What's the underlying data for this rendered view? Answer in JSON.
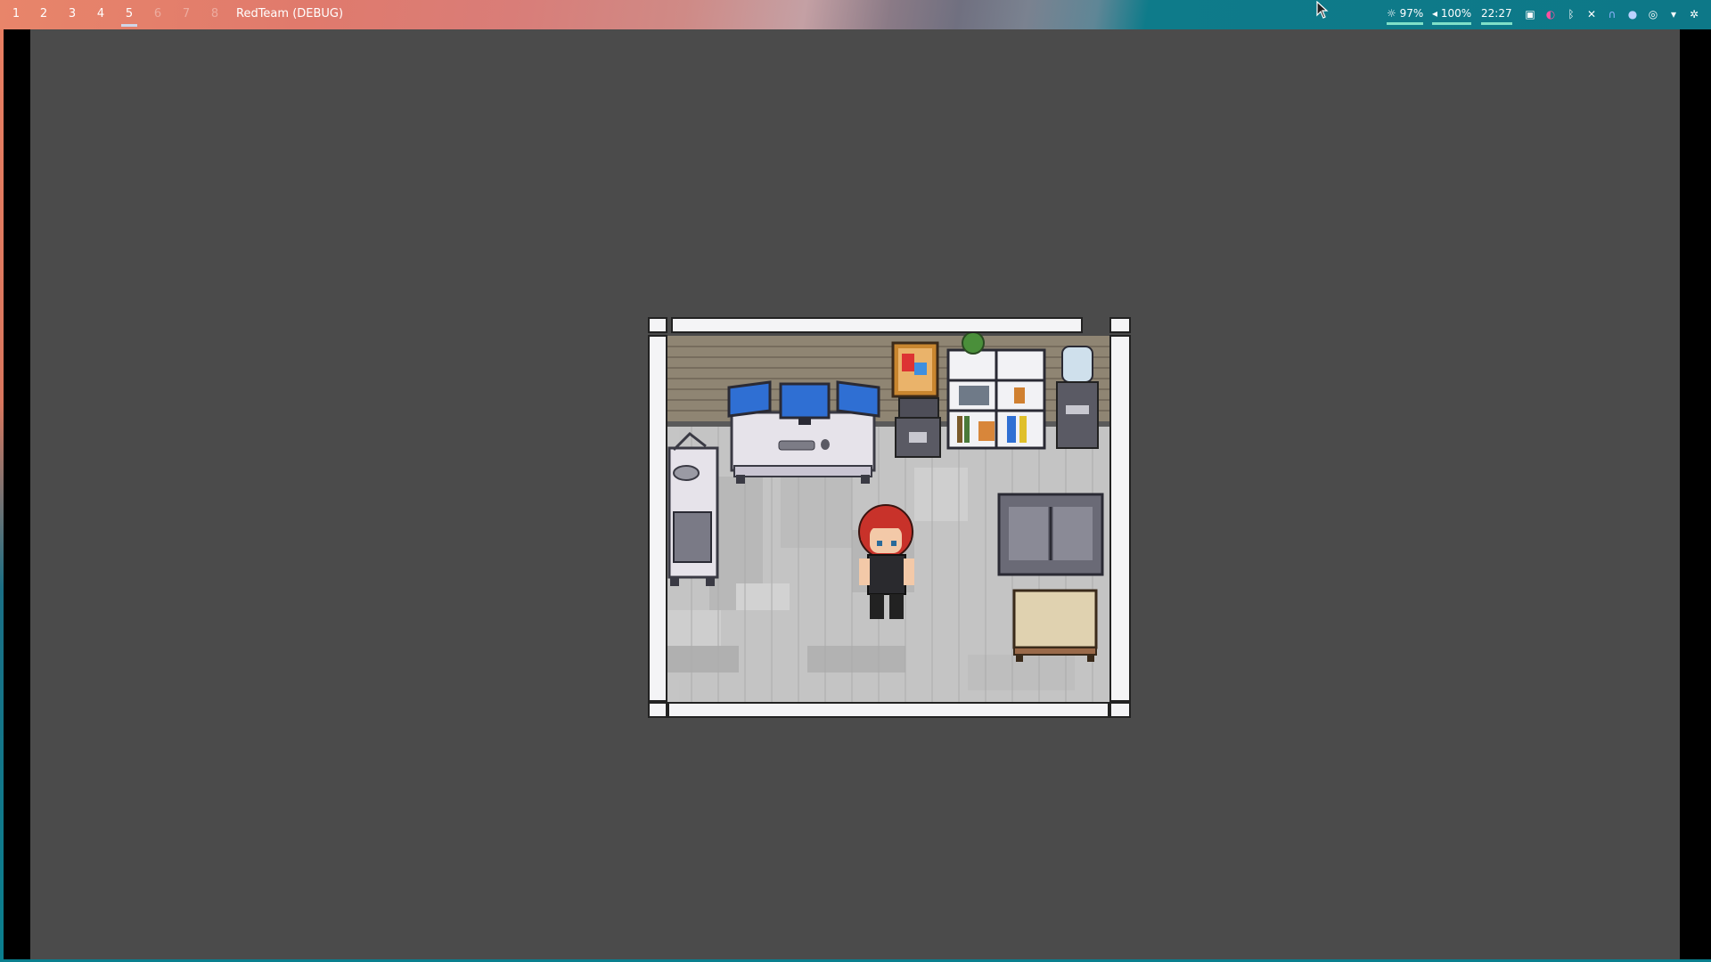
{
  "topbar": {
    "workspaces": [
      "1",
      "2",
      "3",
      "4",
      "5",
      "6",
      "7",
      "8"
    ],
    "active_workspace": "5",
    "window_title": "RedTeam (DEBUG)",
    "brightness": "97%",
    "volume": "100%",
    "clock": "22:27"
  },
  "tray_icons": [
    "screen-icon",
    "color-icon",
    "bluetooth-icon",
    "tool-icon",
    "headphones-icon",
    "app-icon",
    "network-icon",
    "wifi-icon",
    "snowflake-icon"
  ],
  "game": {
    "scene": "office-room",
    "character": "red-haired-player"
  }
}
